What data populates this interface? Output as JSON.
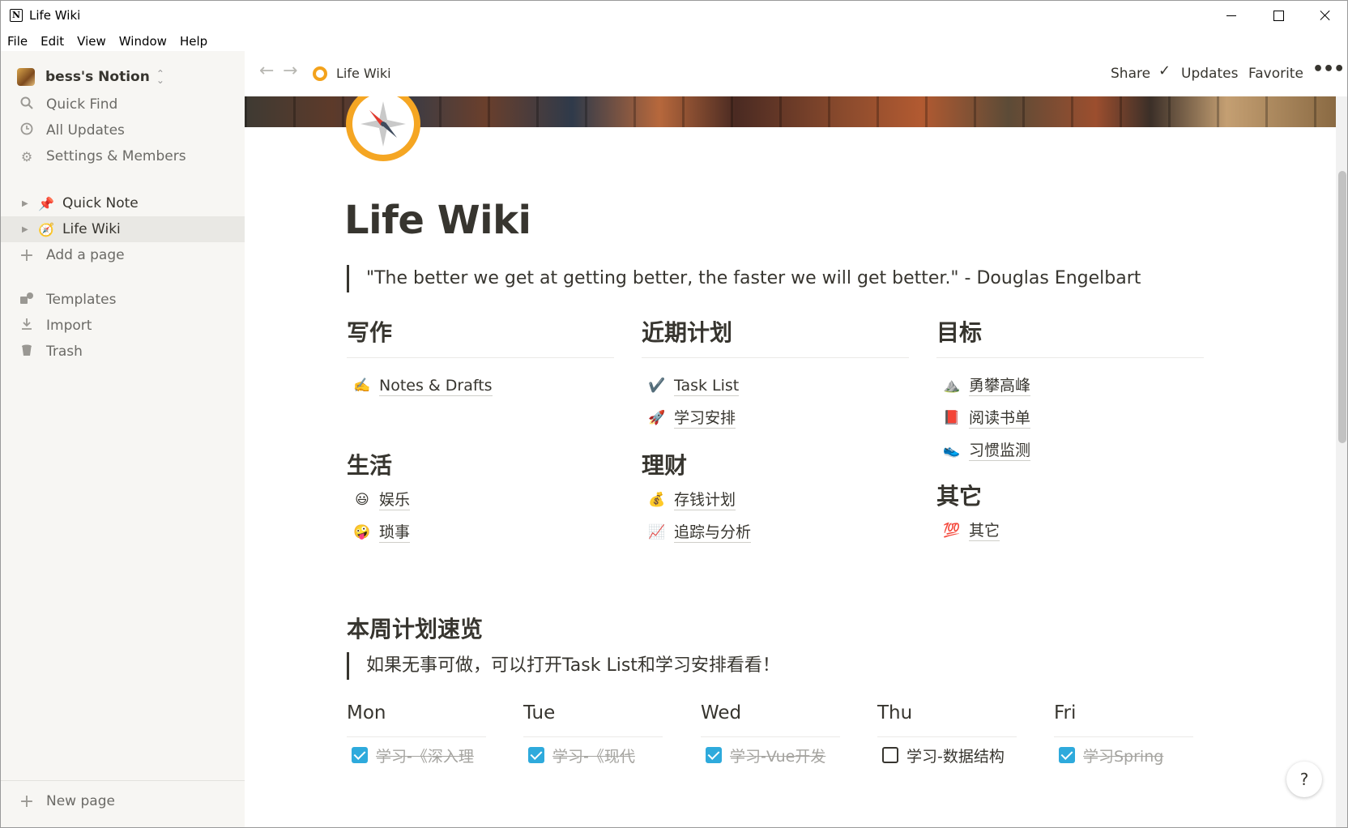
{
  "window": {
    "title": "Life Wiki"
  },
  "menu": [
    "File",
    "Edit",
    "View",
    "Window",
    "Help"
  ],
  "sidebar": {
    "workspace": "bess's Notion",
    "actions": [
      {
        "label": "Quick Find",
        "icon": "search-icon"
      },
      {
        "label": "All Updates",
        "icon": "clock-icon"
      },
      {
        "label": "Settings & Members",
        "icon": "gear-icon"
      }
    ],
    "pages": [
      {
        "label": "Quick Note",
        "emoji": "📌"
      },
      {
        "label": "Life Wiki",
        "emoji": "🧭",
        "selected": true
      }
    ],
    "add_page": "Add a page",
    "tools": [
      {
        "label": "Templates",
        "icon": "templates-icon"
      },
      {
        "label": "Import",
        "icon": "import-icon"
      },
      {
        "label": "Trash",
        "icon": "trash-icon"
      }
    ],
    "new_page": "New page"
  },
  "topbar": {
    "breadcrumb": "Life Wiki",
    "share": "Share",
    "updates": "Updates",
    "favorite": "Favorite",
    "more": "•••"
  },
  "page": {
    "title": "Life Wiki",
    "quote": "\"The better we get at getting better, the faster we will get better.\" - Douglas Engelbart",
    "sections": [
      {
        "title": "写作",
        "links": [
          {
            "emoji": "✍️",
            "label": "Notes & Drafts"
          }
        ]
      },
      {
        "title": "近期计划",
        "links": [
          {
            "emoji": "✔️",
            "label": "Task List"
          },
          {
            "emoji": "🚀",
            "label": "学习安排"
          }
        ]
      },
      {
        "title": "目标",
        "links": [
          {
            "emoji": "⛰️",
            "label": "勇攀高峰"
          },
          {
            "emoji": "📕",
            "label": "阅读书单"
          },
          {
            "emoji": "👟",
            "label": "习惯监测"
          }
        ]
      },
      {
        "title": "生活",
        "links": [
          {
            "emoji": "😃",
            "label": "娱乐"
          },
          {
            "emoji": "🤪",
            "label": "琐事"
          }
        ]
      },
      {
        "title": "理财",
        "links": [
          {
            "emoji": "💰",
            "label": "存钱计划"
          },
          {
            "emoji": "📈",
            "label": "追踪与分析"
          }
        ]
      },
      {
        "title": "其它",
        "links": [
          {
            "emoji": "💯",
            "label": "其它"
          }
        ]
      }
    ],
    "week_title": "本周计划速览",
    "week_quote": "如果无事可做，可以打开Task List和学习安排看看！",
    "days": [
      {
        "name": "Mon",
        "task": "学习-《深入理",
        "done": true
      },
      {
        "name": "Tue",
        "task": "学习-《现代",
        "done": true
      },
      {
        "name": "Wed",
        "task": "学习-Vue开发",
        "done": true
      },
      {
        "name": "Thu",
        "task": "学习-数据结构",
        "done": false
      },
      {
        "name": "Fri",
        "task": "学习Spring",
        "done": true
      }
    ]
  },
  "help": "?"
}
